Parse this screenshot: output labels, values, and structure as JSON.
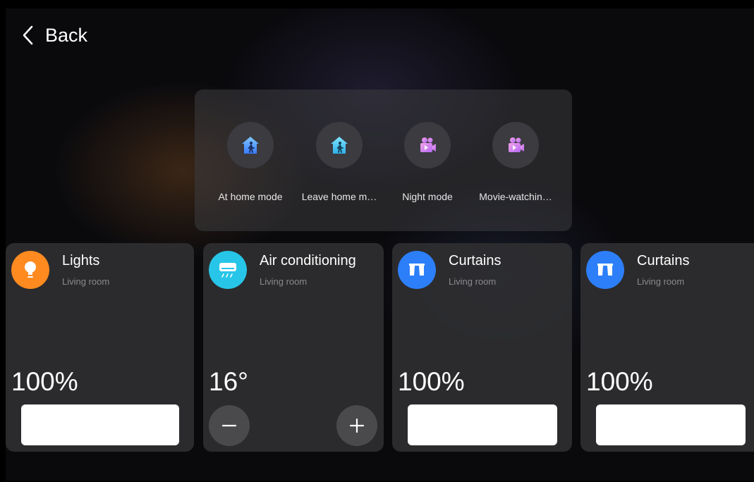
{
  "header": {
    "back_label": "Back"
  },
  "scenes": [
    {
      "label": "At home mode",
      "icon": "home-person-icon"
    },
    {
      "label": "Leave home m…",
      "icon": "home-person-icon"
    },
    {
      "label": "Night mode",
      "icon": "movie-camera-icon"
    },
    {
      "label": "Movie-watchin…",
      "icon": "movie-camera-icon"
    }
  ],
  "devices": [
    {
      "title": "Lights",
      "room": "Living room",
      "value": "100%",
      "icon": "lightbulb-icon",
      "color": "#ff8a1f",
      "level": 1.0
    },
    {
      "title": "Air conditioning",
      "room": "Living room",
      "value": "16°",
      "icon": "air-conditioner-icon",
      "color": "#27c6e8"
    },
    {
      "title": "Curtains",
      "room": "Living room",
      "value": "100%",
      "icon": "curtain-icon",
      "color": "#2d7ff9",
      "level": 1.0
    },
    {
      "title": "Curtains",
      "room": "Living room",
      "value": "100%",
      "icon": "curtain-icon",
      "color": "#2d7ff9",
      "level": 1.0
    }
  ]
}
